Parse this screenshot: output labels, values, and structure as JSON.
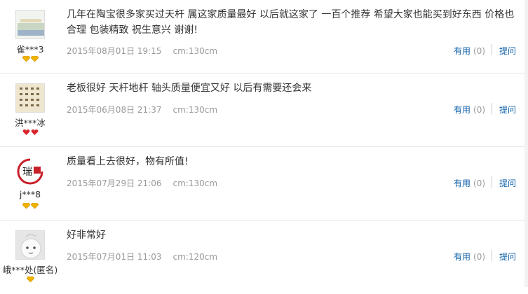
{
  "reviews": [
    {
      "username": "雀***3",
      "avatar_icon": "scenery-thumbnail",
      "badge_type": "gold-diamond",
      "badge_count": 2,
      "content": "几年在陶宝很多家买过天杆 属这家质量最好 以后就这家了 一百个推荐 希望大家也能买到好东西 价格也合理 包装精致 祝生意兴 谢谢!",
      "date": "2015年08月01日 19:15",
      "size": "cm:130cm",
      "useful_label": "有用",
      "useful_count": "(0)",
      "ask_label": "提问"
    },
    {
      "username": "洪***冰",
      "avatar_icon": "calligraphy-thumbnail",
      "badge_type": "red-heart",
      "badge_count": 2,
      "content": "老板很好 天杆地杆 轴头质量便宜又好 以后有需要还会来",
      "date": "2015年06月08日 21:37",
      "size": "cm:130cm",
      "useful_label": "有用",
      "useful_count": "(0)",
      "ask_label": "提问"
    },
    {
      "username": "j***8",
      "avatar_icon": "shop-logo",
      "avatar_text": "瑞",
      "badge_type": "gold-diamond",
      "badge_count": 2,
      "content": "质量看上去很好，物有所值!",
      "date": "2015年07月29日 21:06",
      "size": "cm:130cm",
      "useful_label": "有用",
      "useful_count": "(0)",
      "ask_label": "提问"
    },
    {
      "username": "峨***处(匿名)",
      "avatar_icon": "default-face",
      "badge_type": "gold-diamond",
      "badge_count": 1,
      "content": "好非常好",
      "date": "2015年07月01日 11:03",
      "size": "cm:120cm",
      "useful_label": "有用",
      "useful_count": "(0)",
      "ask_label": "提问"
    }
  ],
  "colors": {
    "link": "#0b5ea8",
    "meta": "#999999",
    "gold": "#f0b400",
    "red": "#d9262c"
  }
}
